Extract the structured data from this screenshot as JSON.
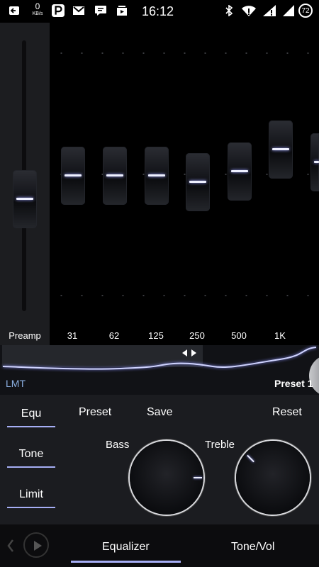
{
  "status": {
    "speed_value": "0",
    "speed_unit": "KB/s",
    "time": "16:12",
    "battery": "72"
  },
  "equalizer": {
    "preamp_label": "Preamp",
    "bands": [
      {
        "label": "31"
      },
      {
        "label": "62"
      },
      {
        "label": "125"
      },
      {
        "label": "250"
      },
      {
        "label": "500"
      },
      {
        "label": "1K"
      }
    ]
  },
  "curve": {
    "limiter_label": "LMT",
    "preset_name": "Preset 1"
  },
  "controls": {
    "tabs": [
      {
        "label": "Equ"
      },
      {
        "label": "Tone"
      },
      {
        "label": "Limit"
      }
    ],
    "actions": {
      "preset": "Preset",
      "save": "Save",
      "reset": "Reset"
    },
    "bass_label": "Bass",
    "treble_label": "Treble"
  },
  "bottom": {
    "tab_equalizer": "Equalizer",
    "tab_tone": "Tone/Vol"
  },
  "colors": {
    "accent": "#a6aef5",
    "limiter_text": "#8aaee0"
  }
}
